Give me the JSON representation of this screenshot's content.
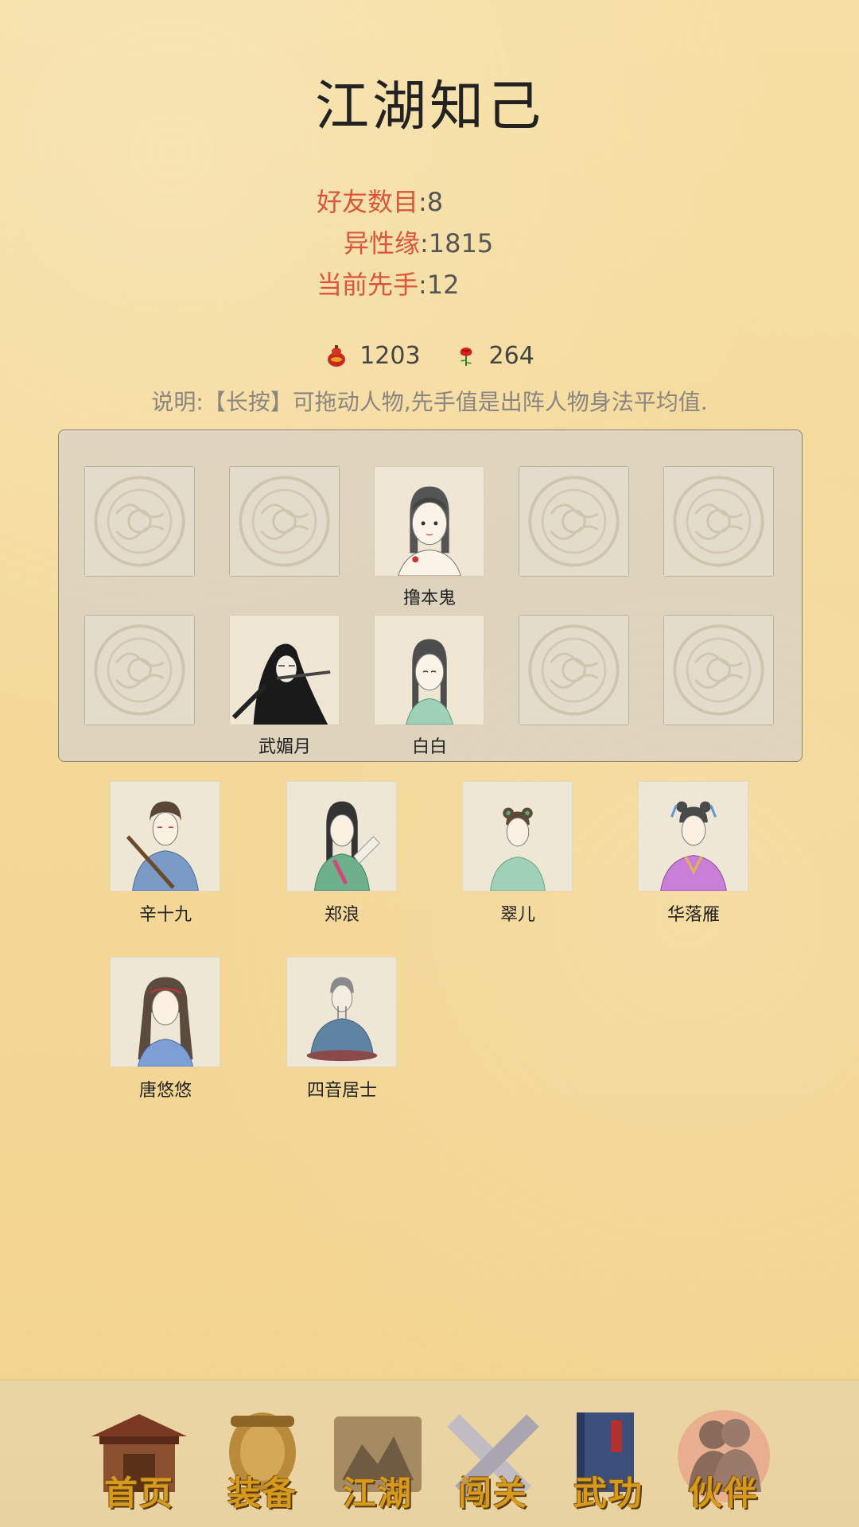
{
  "title": "江湖知己",
  "stats": {
    "friends_label": "好友数目",
    "friends_value": ":8",
    "affinity_label": "异性缘",
    "affinity_value": ":1815",
    "initiative_label": "当前先手",
    "initiative_value": ":12"
  },
  "currency": {
    "gourd_icon": "red-gourd-icon",
    "gourd_value": "1203",
    "rose_icon": "rose-icon",
    "rose_value": "264"
  },
  "note": "说明:【长按】可拖动人物,先手值是出阵人物身法平均值.",
  "formation": {
    "row1": [
      "",
      "",
      "撸本鬼",
      "",
      ""
    ],
    "row2": [
      "",
      "武媚月",
      "白白",
      "",
      ""
    ]
  },
  "friends": [
    {
      "name": "辛十九"
    },
    {
      "name": "郑浪"
    },
    {
      "name": "翠儿"
    },
    {
      "name": "华落雁"
    },
    {
      "name": "唐悠悠"
    },
    {
      "name": "四音居士"
    }
  ],
  "nav": [
    {
      "label": "首页",
      "icon": "house-icon"
    },
    {
      "label": "装备",
      "icon": "armor-icon"
    },
    {
      "label": "江湖",
      "icon": "scroll-map-icon"
    },
    {
      "label": "闯关",
      "icon": "crossed-swords-icon"
    },
    {
      "label": "武功",
      "icon": "book-icon"
    },
    {
      "label": "伙伴",
      "icon": "partners-icon"
    }
  ],
  "colors": {
    "stat_label": "#d9563a",
    "nav_label": "#d89a1c",
    "background": "#f4d898"
  }
}
